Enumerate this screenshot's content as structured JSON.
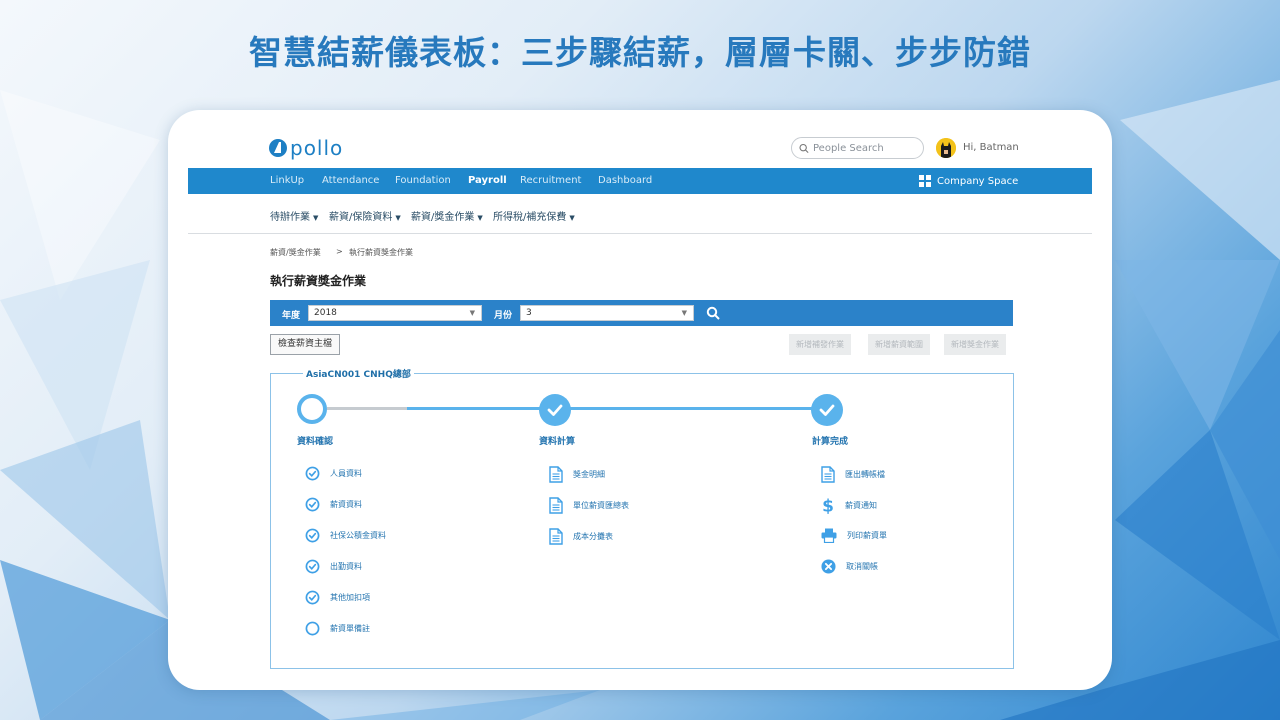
{
  "slide": {
    "title": "智慧結薪儀表板：三步驟結薪，層層卡關、步步防錯"
  },
  "header": {
    "logo_text": "pollo",
    "search_placeholder": "People Search",
    "greeting": "Hi, Batman"
  },
  "nav": {
    "items": [
      "LinkUp",
      "Attendance",
      "Foundation",
      "Payroll",
      "Recruitment",
      "Dashboard"
    ],
    "active": "Payroll",
    "company_space": "Company Space"
  },
  "subnav": {
    "items": [
      "待辦作業",
      "薪資/保險資料",
      "薪資/獎金作業",
      "所得稅/補充保費"
    ]
  },
  "breadcrumb": {
    "parent": "薪資/獎金作業",
    "separator": ">",
    "current": "執行薪資獎金作業"
  },
  "page": {
    "title": "執行薪資獎金作業"
  },
  "filters": {
    "year_label": "年度",
    "year_value": "2018",
    "month_label": "月份",
    "month_value": "3"
  },
  "buttons": {
    "check_master": "檢查薪資主檔",
    "add_supplement": "新增補發作業",
    "add_salary_range": "新增薪資範圍",
    "add_bonus": "新增獎金作業"
  },
  "panel": {
    "legend": "AsiaCN001 CNHQ總部",
    "steps": [
      "資料確認",
      "資料計算",
      "計算完成"
    ],
    "step1_items": [
      {
        "label": "人員資料",
        "done": true
      },
      {
        "label": "薪資資料",
        "done": true
      },
      {
        "label": "社保公積金資料",
        "done": true
      },
      {
        "label": "出勤資料",
        "done": true
      },
      {
        "label": "其他加扣項",
        "done": true
      },
      {
        "label": "薪資單備註",
        "done": false
      }
    ],
    "step2_items": [
      "獎金明細",
      "單位薪資匯總表",
      "成本分攤表"
    ],
    "step3_items": [
      {
        "label": "匯出轉帳檔",
        "icon": "document-icon"
      },
      {
        "label": "薪資通知",
        "icon": "dollar-icon"
      },
      {
        "label": "列印薪資單",
        "icon": "printer-icon"
      },
      {
        "label": "取消關帳",
        "icon": "cancel-icon"
      }
    ]
  },
  "colors": {
    "brand": "#1f88cc",
    "accent": "#5ab3ec",
    "title": "#2779bd"
  }
}
